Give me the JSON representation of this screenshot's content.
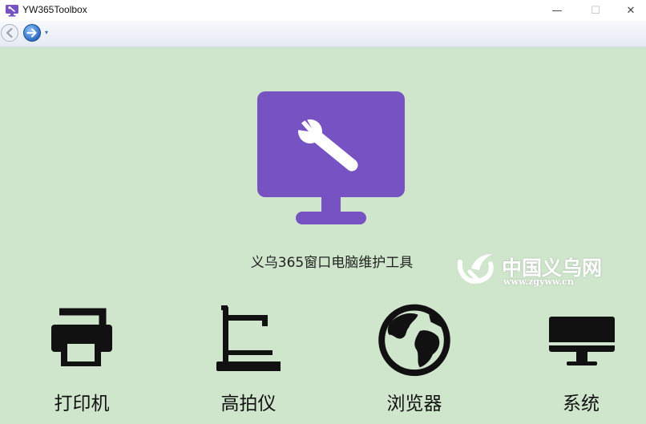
{
  "window": {
    "title": "YW365Toolbox",
    "controls": {
      "minimize": "—",
      "maximize": "☐",
      "close": "✕"
    }
  },
  "nav": {
    "back_icon": "back-arrow-icon",
    "forward_icon": "forward-arrow-icon",
    "dropdown": "▾"
  },
  "hero": {
    "icon": "monitor-wrench-icon",
    "title": "义乌365窗口电脑维护工具",
    "accent": "#7652c2"
  },
  "watermark": {
    "text": "中国义乌网",
    "url": "www.zgyww.cn"
  },
  "tiles": [
    {
      "label": "打印机",
      "icon": "printer-icon"
    },
    {
      "label": "高拍仪",
      "icon": "document-camera-icon"
    },
    {
      "label": "浏览器",
      "icon": "globe-icon"
    },
    {
      "label": "系统",
      "icon": "desktop-monitor-icon"
    }
  ],
  "colors": {
    "background": "#cfe6cc",
    "icon_dark": "#111111"
  }
}
